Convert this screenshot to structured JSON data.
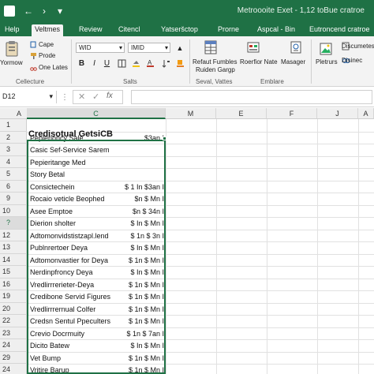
{
  "window": {
    "title": "Metroooite Exet - 1,12 toBue cratroe"
  },
  "tabs": [
    {
      "label": "Help",
      "active": false
    },
    {
      "label": "Veltmes",
      "active": true
    },
    {
      "label": "Review",
      "active": false
    },
    {
      "label": "Citencl",
      "active": false
    },
    {
      "label": "Yatseršctop",
      "active": false
    },
    {
      "label": "Prorne",
      "active": false
    },
    {
      "label": "Aspcal - Bin",
      "active": false
    },
    {
      "label": "Eutroncend cratroe",
      "active": false
    }
  ],
  "ribbon": {
    "clipboard": {
      "big_button_label": "Yormow",
      "small_items": [
        "Cape",
        "Prode",
        "One Lates"
      ],
      "group_label": "Cellecture"
    },
    "font": {
      "font_name": "WID",
      "font_size": "IMID",
      "group_label": "Salts"
    },
    "styles": {
      "buttons": [
        "Refaut Fumbles",
        "Ruiden Gargp",
        "Roerfior Nate",
        "Masager"
      ],
      "group_label": "Seval, Vattes"
    },
    "cells": {
      "group_label": "Emblare"
    },
    "editing": {
      "buttons": [
        "Pletrurs",
        "Discumetes",
        "Disinec"
      ]
    }
  },
  "formula_bar": {
    "name_box": "D12",
    "formula": ""
  },
  "grid": {
    "columns": [
      "A",
      "C",
      "M",
      "E",
      "F",
      "J",
      "A"
    ],
    "selected_column_index": 1,
    "heading": "Credisotual GetsiCB",
    "rows": [
      {
        "num": "1",
        "a": "",
        "b": ""
      },
      {
        "num": "2",
        "a": "Peplerioncy Sale",
        "b": "$3an I"
      },
      {
        "num": "3",
        "a": "Casic Sef-Service Sarem",
        "b": ""
      },
      {
        "num": "4",
        "a": "Pepieritange Med",
        "b": ""
      },
      {
        "num": "5",
        "a": "Story Betal",
        "b": ""
      },
      {
        "num": "6",
        "a": "Consictechein",
        "b": "$ 1 In $3an I"
      },
      {
        "num": "9",
        "a": "Rocaio veticle Beophed",
        "b": "$n $ Mn I"
      },
      {
        "num": "10",
        "a": "Asee Emptoe",
        "b": "$n $ 34n I"
      },
      {
        "num": "?",
        "a": "Dierion sholter",
        "b": "$ In $ Mn I"
      },
      {
        "num": "12",
        "a": "Adtomonvidstistzapl.lend",
        "b": "$ 1n $ 3n I"
      },
      {
        "num": "13",
        "a": "Publnrertoer Deya",
        "b": "$ In $ Mn I"
      },
      {
        "num": "14",
        "a": "Adtomonvastier for Deya",
        "b": "$ 1n $ Mn I"
      },
      {
        "num": "15",
        "a": "Nerdinpfroncy Deya",
        "b": "$ In $ Mn I"
      },
      {
        "num": "16",
        "a": "Vredlirrrerieter-Deya",
        "b": "$ 1n $ Mn I"
      },
      {
        "num": "19",
        "a": "Credibone Servid Figures",
        "b": "$ 1n $ Mn I"
      },
      {
        "num": "20",
        "a": "Vredlirrrernual Colfer",
        "b": "$ 1n $ Mn I"
      },
      {
        "num": "22",
        "a": "Credsn Sentul Ppeculters",
        "b": "$ 1n $ Mn I"
      },
      {
        "num": "23",
        "a": "Crevio Docrmuity",
        "b": "$ 1n $ 7an I"
      },
      {
        "num": "24",
        "a": "Dicito Batew",
        "b": "$ In $ Mn I"
      },
      {
        "num": "29",
        "a": "Vet Bump",
        "b": "$ 1n $ Mn I"
      },
      {
        "num": "24",
        "a": "Vritire Barup",
        "b": "$ 1n $ Mn I"
      }
    ]
  },
  "icons": {
    "paste": "clipboard-icon",
    "bold": "bold-icon",
    "italic": "italic-icon",
    "underline": "underline-icon",
    "conditional": "table-icon",
    "sort": "sort-icon"
  },
  "colors": {
    "excel_green": "#1f7145",
    "ribbon_bg": "#f3f3f3",
    "header_bg": "#efefef"
  }
}
